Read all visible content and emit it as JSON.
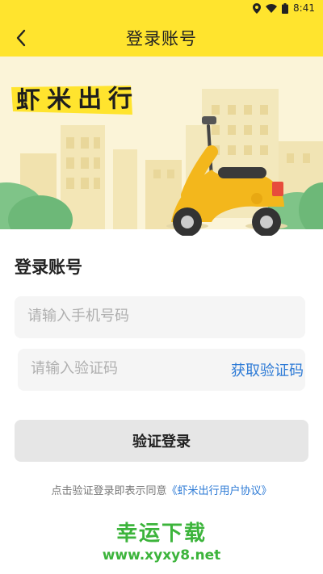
{
  "status_bar": {
    "time": "8:41",
    "icons": [
      "location-icon",
      "wifi-icon",
      "battery-icon"
    ]
  },
  "header": {
    "title": "登录账号",
    "back_icon": "chevron-left-icon"
  },
  "banner": {
    "brand_name": "虾米出行"
  },
  "form": {
    "section_title": "登录账号",
    "phone": {
      "placeholder": "请输入手机号码",
      "value": ""
    },
    "code": {
      "placeholder": "请输入验证码",
      "value": ""
    },
    "get_code_label": "获取验证码",
    "login_button_label": "验证登录",
    "agreement_prefix": "点击验证登录即表示同意",
    "agreement_link": "《虾米出行用户协议》"
  },
  "watermark": {
    "site_name": "幸运下载",
    "site_url": "www.xyxy8.net"
  },
  "colors": {
    "header_yellow": "#FFE42E",
    "link_blue": "#2E7BD6",
    "watermark_green": "#3CB43B",
    "scooter_yellow": "#F3B71C"
  }
}
